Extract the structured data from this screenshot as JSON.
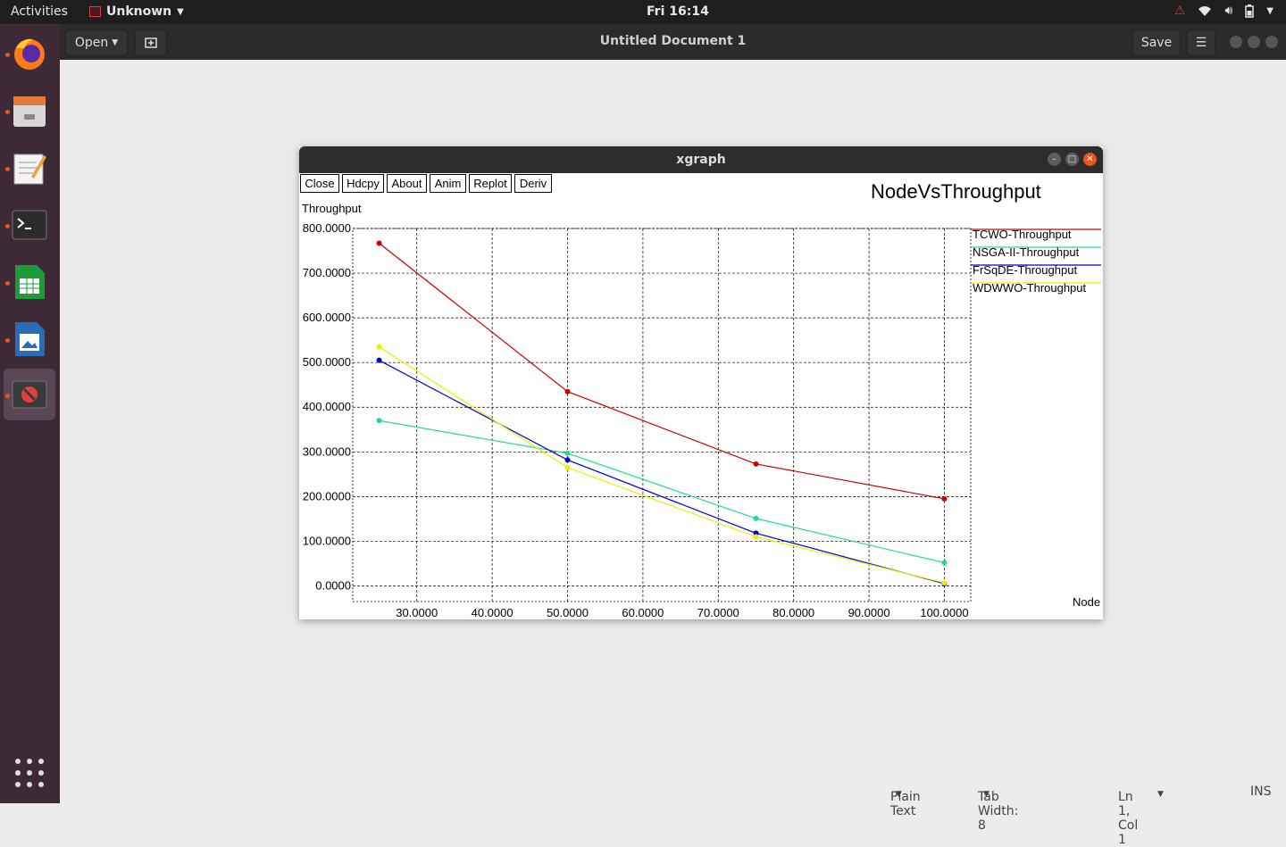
{
  "topbar": {
    "activities": "Activities",
    "app_name": "Unknown",
    "clock": "Fri 16:14"
  },
  "gedit": {
    "open_label": "Open",
    "title": "Untitled Document 1",
    "save_label": "Save"
  },
  "statusbar": {
    "language": "Plain Text",
    "tab_width": "Tab Width: 8",
    "position": "Ln 1, Col 1",
    "mode": "INS"
  },
  "xgraph": {
    "window_title": "xgraph",
    "buttons": [
      "Close",
      "Hdcpy",
      "About",
      "Anim",
      "Replot",
      "Deriv"
    ]
  },
  "chart_data": {
    "type": "line",
    "title": "NodeVsThroughput",
    "xlabel": "Node",
    "ylabel": "Throughput",
    "x": [
      25,
      50,
      75,
      100
    ],
    "xlim": [
      21.5,
      103.5
    ],
    "ylim": [
      -35,
      800
    ],
    "xticks": [
      30,
      40,
      50,
      60,
      70,
      80,
      90,
      100
    ],
    "yticks": [
      0,
      100,
      200,
      300,
      400,
      500,
      600,
      700,
      800
    ],
    "xtick_labels": [
      "30.0000",
      "40.0000",
      "50.0000",
      "60.0000",
      "70.0000",
      "80.0000",
      "90.0000",
      "100.0000"
    ],
    "ytick_labels": [
      "0.0000",
      "100.0000",
      "200.0000",
      "300.0000",
      "400.0000",
      "500.0000",
      "600.0000",
      "700.0000",
      "800.0000"
    ],
    "grid": true,
    "legend_position": "right",
    "series": [
      {
        "name": "TCWO-Throughput",
        "color": "#cc0000",
        "values": [
          767,
          435,
          273,
          195
        ]
      },
      {
        "name": "NSGA-II-Throughput",
        "color": "#22dd88",
        "values": [
          370,
          297,
          151,
          52
        ]
      },
      {
        "name": "FrSqDE-Throughput",
        "color": "#0000cc",
        "values": [
          505,
          282,
          118,
          5
        ]
      },
      {
        "name": "WDWWO-Throughput",
        "color": "#eeee00",
        "values": [
          535,
          265,
          110,
          7
        ]
      }
    ]
  }
}
